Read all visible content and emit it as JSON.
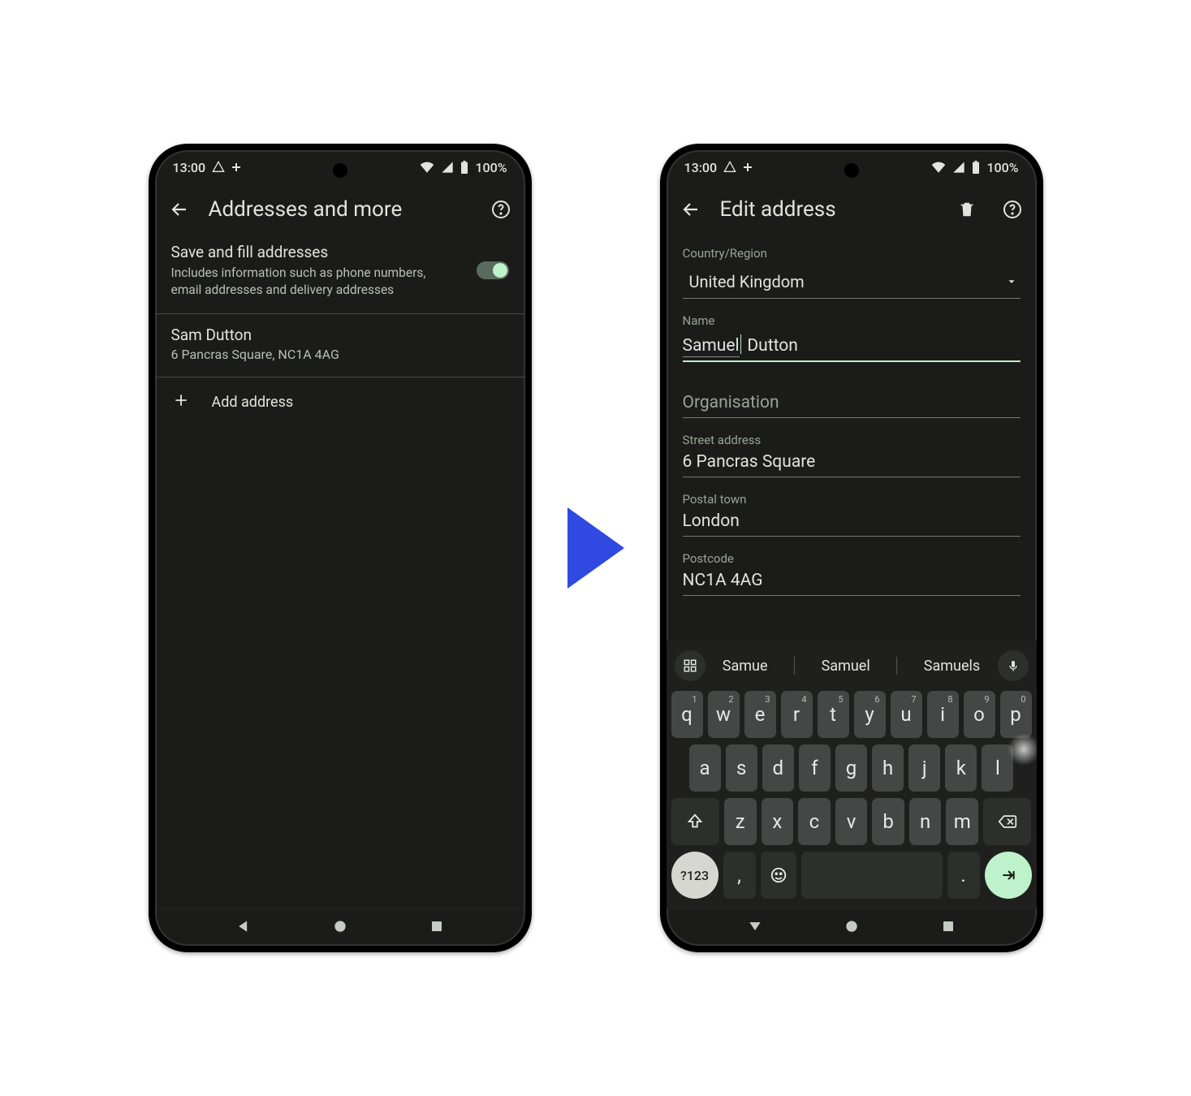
{
  "status": {
    "time": "13:00",
    "battery": "100%"
  },
  "screen1": {
    "title": "Addresses and more",
    "setting": {
      "title": "Save and fill addresses",
      "subtitle": "Includes information such as phone numbers, email addresses and delivery addresses",
      "toggle_on": true
    },
    "saved_address": {
      "name": "Sam Dutton",
      "line": "6 Pancras Square, NC1A 4AG"
    },
    "add_label": "Add address"
  },
  "screen2": {
    "title": "Edit address",
    "fields": {
      "country_label": "Country/Region",
      "country_value": "United Kingdom",
      "name_label": "Name",
      "name_word1": "Samuel",
      "name_word2": "Dutton",
      "org_placeholder": "Organisation",
      "street_label": "Street address",
      "street_value": "6 Pancras Square",
      "town_label": "Postal town",
      "town_value": "London",
      "postcode_label": "Postcode",
      "postcode_value": "NC1A 4AG"
    },
    "keyboard": {
      "suggestions": [
        "Samue",
        "Samuel",
        "Samuels"
      ],
      "row1": [
        {
          "k": "q",
          "h": "1"
        },
        {
          "k": "w",
          "h": "2"
        },
        {
          "k": "e",
          "h": "3"
        },
        {
          "k": "r",
          "h": "4"
        },
        {
          "k": "t",
          "h": "5"
        },
        {
          "k": "y",
          "h": "6"
        },
        {
          "k": "u",
          "h": "7"
        },
        {
          "k": "i",
          "h": "8"
        },
        {
          "k": "o",
          "h": "9"
        },
        {
          "k": "p",
          "h": "0"
        }
      ],
      "row2": [
        "a",
        "s",
        "d",
        "f",
        "g",
        "h",
        "j",
        "k",
        "l"
      ],
      "row3": [
        "z",
        "x",
        "c",
        "v",
        "b",
        "n",
        "m"
      ],
      "symkey": "?123",
      "comma": ",",
      "period": "."
    }
  }
}
